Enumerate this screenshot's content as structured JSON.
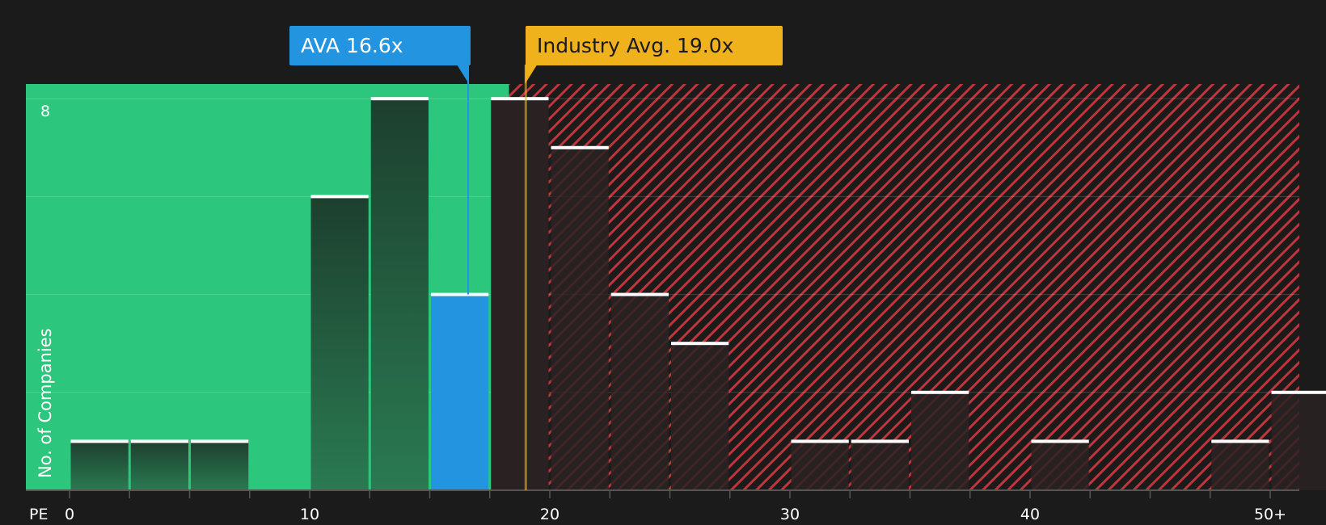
{
  "callouts": {
    "company": "AVA 16.6x",
    "industry": "Industry Avg. 19.0x"
  },
  "colors": {
    "background": "#1b1b1b",
    "undervalued_zone": "#2cc67d",
    "overvalued_zone": "#c0343a",
    "company": "#2394e0",
    "industry": "#efb11c",
    "bar_dark": "#1f4a34",
    "bar_overvalued": "#2a2222"
  },
  "chart_data": {
    "type": "bar",
    "xlabel": "PE",
    "ylabel": "No. of Companies",
    "xlim": [
      0,
      50.5
    ],
    "ylim": [
      0,
      8.3
    ],
    "x_ticks": [
      {
        "value": 0,
        "label": "0"
      },
      {
        "value": 10,
        "label": "10"
      },
      {
        "value": 20,
        "label": "20"
      },
      {
        "value": 30,
        "label": "30"
      },
      {
        "value": 40,
        "label": "40"
      },
      {
        "value": 50,
        "label": "50+"
      }
    ],
    "minor_ticks": [
      0,
      2.5,
      5,
      7.5,
      10,
      12.5,
      15,
      17.5,
      20,
      22.5,
      25,
      27.5,
      30,
      32.5,
      35,
      37.5,
      40,
      42.5,
      45,
      47.5,
      50
    ],
    "y_ticks": [
      {
        "value": 8,
        "label": "8"
      }
    ],
    "gridlines": [
      2,
      4,
      6,
      8
    ],
    "bin_width": 2.5,
    "bins": [
      {
        "start": 0,
        "count": 1
      },
      {
        "start": 2.5,
        "count": 1
      },
      {
        "start": 5,
        "count": 1
      },
      {
        "start": 7.5,
        "count": 0
      },
      {
        "start": 10,
        "count": 6
      },
      {
        "start": 12.5,
        "count": 8
      },
      {
        "start": 15,
        "count": 4,
        "highlight": true
      },
      {
        "start": 17.5,
        "count": 8
      },
      {
        "start": 20,
        "count": 7
      },
      {
        "start": 22.5,
        "count": 4
      },
      {
        "start": 25,
        "count": 3
      },
      {
        "start": 27.5,
        "count": 0
      },
      {
        "start": 30,
        "count": 1
      },
      {
        "start": 32.5,
        "count": 1
      },
      {
        "start": 35,
        "count": 2
      },
      {
        "start": 37.5,
        "count": 0
      },
      {
        "start": 40,
        "count": 1
      },
      {
        "start": 42.5,
        "count": 0
      },
      {
        "start": 45,
        "count": 0
      },
      {
        "start": 47.5,
        "count": 1
      },
      {
        "start": 50,
        "count": 2
      }
    ],
    "company_value": 16.6,
    "industry_value": 19.0,
    "zone_split": 18.3
  }
}
